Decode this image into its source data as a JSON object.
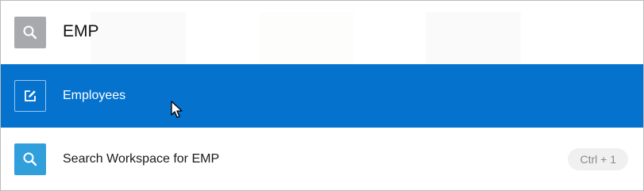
{
  "search": {
    "query": "EMP",
    "icon": "search-icon"
  },
  "results": [
    {
      "label": "Employees",
      "icon": "edit-icon",
      "state": "highlighted"
    },
    {
      "label": "Search Workspace for EMP",
      "icon": "search-icon",
      "shortcut": "Ctrl + 1"
    }
  ],
  "colors": {
    "highlight": "#0572ce",
    "search_icon_bg": "#a7a9ac",
    "result_icon_bg": "#309fdb"
  }
}
